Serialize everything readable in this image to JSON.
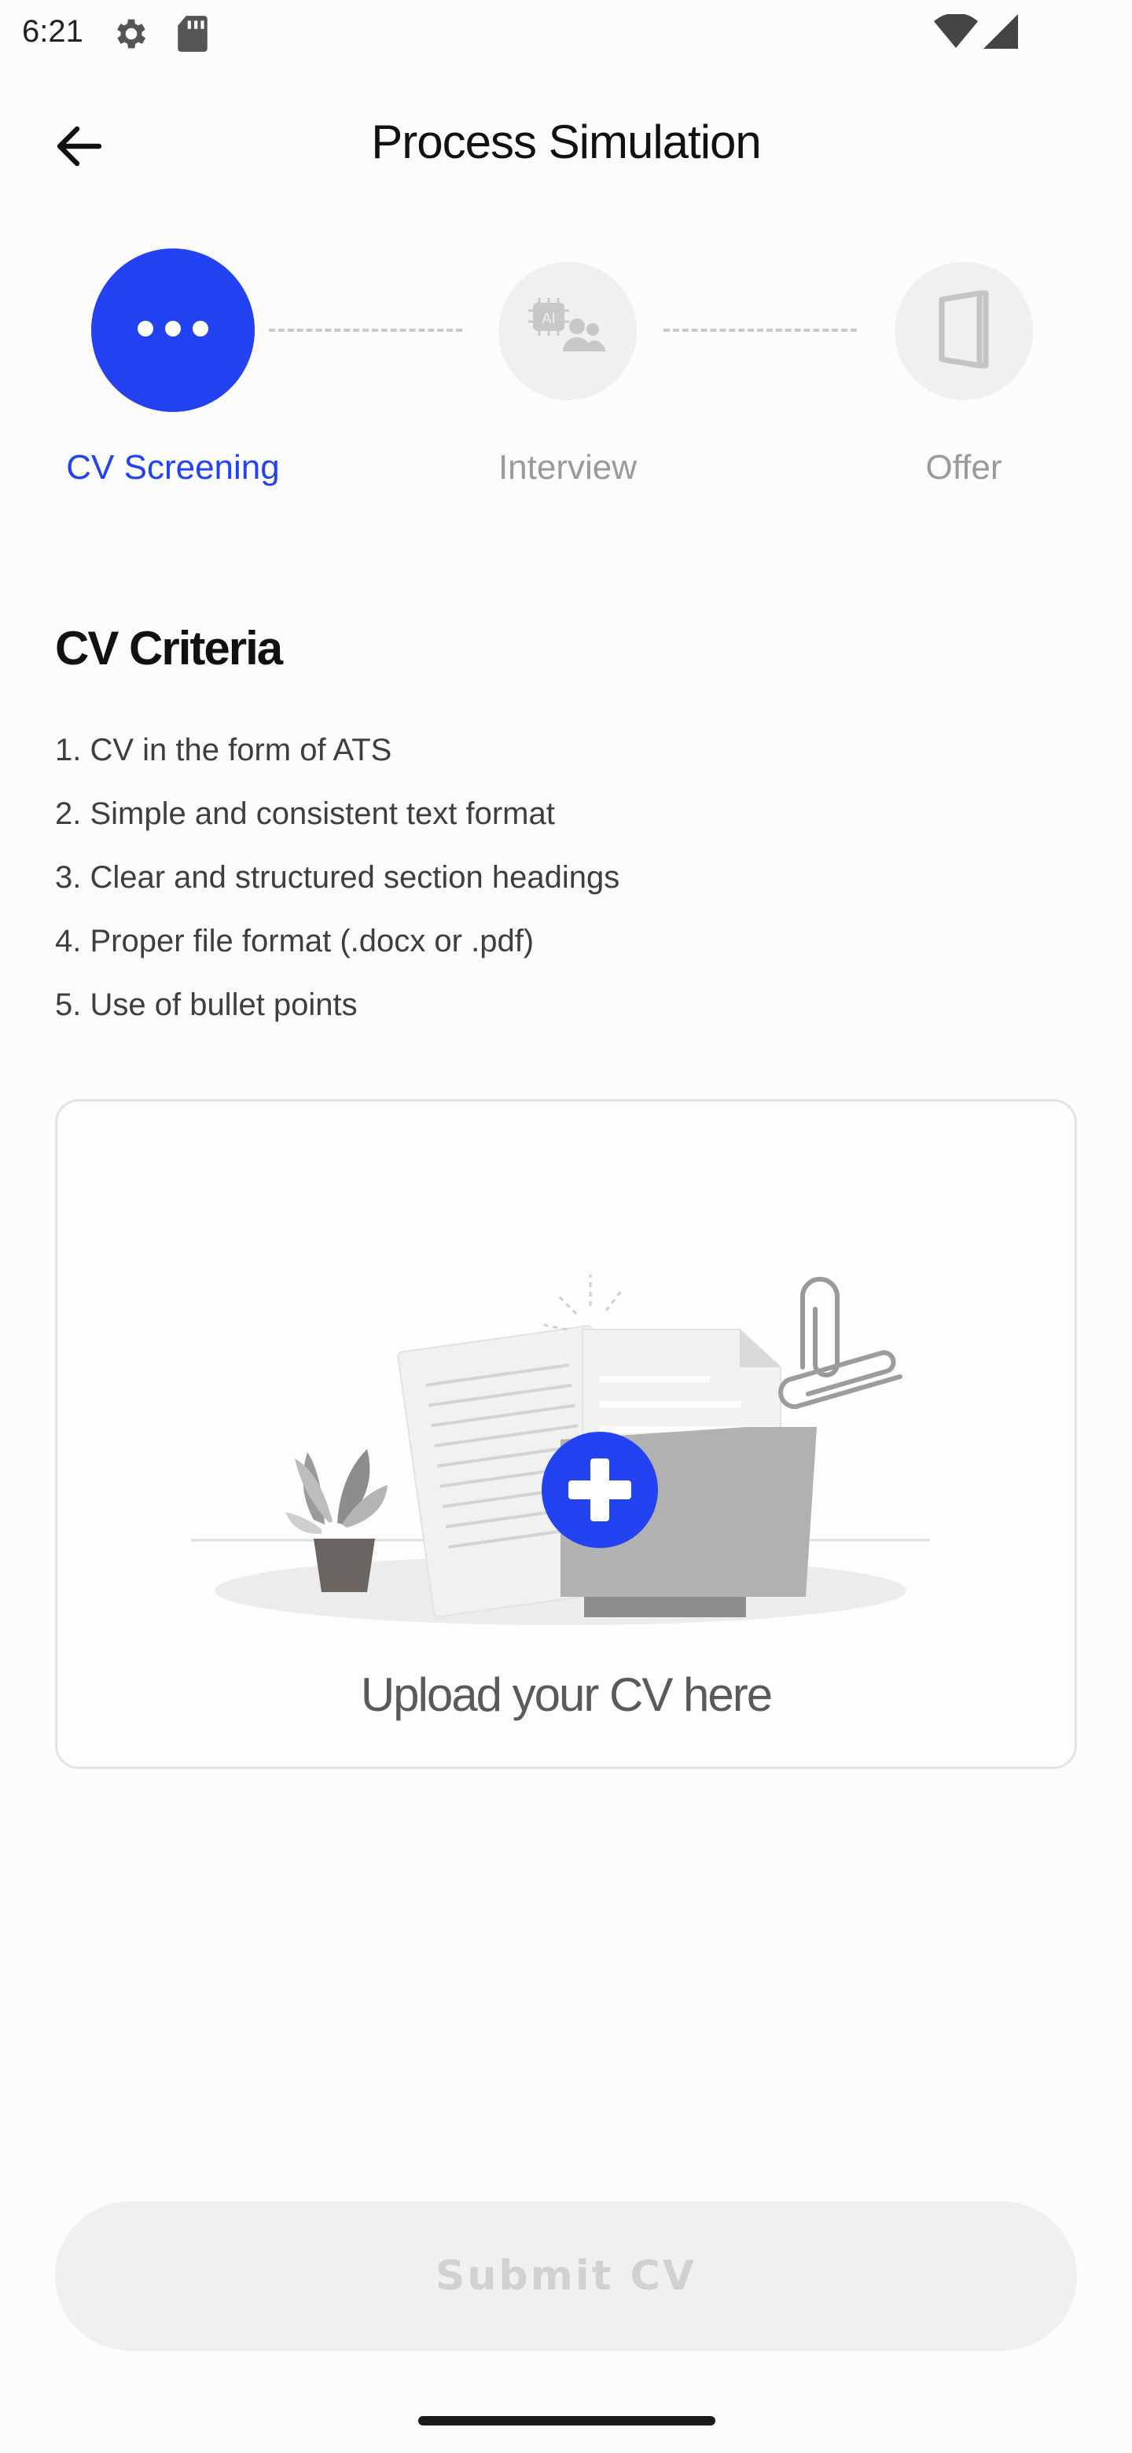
{
  "status_bar": {
    "time": "6:21",
    "icons": [
      "gear-icon",
      "sd-card-icon",
      "wifi-icon",
      "signal-icon"
    ]
  },
  "app_bar": {
    "title": "Process Simulation",
    "back_icon": "arrow-left-icon"
  },
  "stepper": {
    "steps": [
      {
        "label": "CV Screening",
        "icon": "more-horizontal-icon",
        "state": "active"
      },
      {
        "label": "Interview",
        "icon": "ai-interview-icon",
        "state": "inactive"
      },
      {
        "label": "Offer",
        "icon": "door-icon",
        "state": "inactive"
      }
    ]
  },
  "criteria": {
    "title": "CV Criteria",
    "items": [
      "1. CV in the form of ATS",
      "2. Simple and consistent text format",
      "3. Clear and structured section headings",
      "4. Proper file format (.docx or .pdf)",
      "5. Use of bullet points"
    ]
  },
  "upload": {
    "label": "Upload your CV here",
    "illustration": "folder-upload-illustration"
  },
  "submit": {
    "label": "Submit CV",
    "enabled": false
  },
  "colors": {
    "accent": "#2342f2",
    "inactive_circle": "#f0f0f0",
    "inactive_text": "#9a9a9a",
    "disabled_button_bg": "#f1f0f0",
    "disabled_button_text": "#d2d0d0"
  }
}
